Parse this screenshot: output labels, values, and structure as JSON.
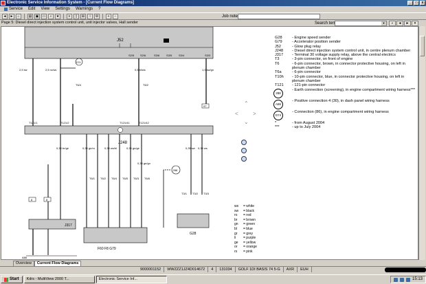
{
  "window": {
    "title": "Electronic Service Information System - [Current Flow Diagrams]"
  },
  "menu": [
    "Service",
    "Edit",
    "View",
    "Settings",
    "Warnings",
    "?"
  ],
  "toolbar": {
    "job_note_label": "Job note:",
    "job_note_value": ""
  },
  "page": {
    "title": "Page 5: Diesel direct injection system control unit, unit injector valves, Hall sender"
  },
  "search": {
    "label": "Search term:",
    "value": ""
  },
  "legend": [
    {
      "key": "G28",
      "text": "- Engine speed sender"
    },
    {
      "key": "G79",
      "text": "- Accelerator position sender"
    },
    {
      "key": "J52",
      "text": "- Glow plug relay"
    },
    {
      "key": "J248",
      "text": "- Diesel direct injection system control unit, in centre plenum chamber"
    },
    {
      "key": "J317",
      "text": "- Terminal 30 voltage supply relay, above the central electrics"
    },
    {
      "key": "T3",
      "text": "- 3-pin connector, on front of engine"
    },
    {
      "key": "T6",
      "text": "- 6-pin connector, brown, in connector protective housing, on left in plenum chamber"
    },
    {
      "key": "T6a",
      "text": "- 6-pin connector"
    },
    {
      "key": "T10h",
      "text": "- 10-pin connector, blue, in connector protective housing, on left in plenum chamber"
    },
    {
      "key": "T121",
      "text": "- 121-pin connector"
    },
    {
      "key": "288",
      "text": "- Earth connection (screening), in engine compartment wiring harness***",
      "circle": true
    },
    {
      "key": "A86",
      "text": "- Positive connection 4 (30), in dash panel wiring harness",
      "circle": true
    },
    {
      "key": "D74",
      "text": "- Connection (86), in engine compartment wiring harness",
      "circle": true
    },
    {
      "key": "*",
      "text": "- from August 2004"
    },
    {
      "key": "***",
      "text": "- up to July 2004"
    }
  ],
  "colors": [
    {
      "code": "ws",
      "name": "= white"
    },
    {
      "code": "sw",
      "name": "= black"
    },
    {
      "code": "ro",
      "name": "= red"
    },
    {
      "code": "br",
      "name": "= brown"
    },
    {
      "code": "gn",
      "name": "= green"
    },
    {
      "code": "bl",
      "name": "= blue"
    },
    {
      "code": "gr",
      "name": "= grey"
    },
    {
      "code": "li",
      "name": "= purple"
    },
    {
      "code": "ge",
      "name": "= yellow"
    },
    {
      "code": "or",
      "name": "= orange"
    },
    {
      "code": "rs",
      "name": "= pink"
    }
  ],
  "diagram": {
    "j52": "J52",
    "j248": "J248",
    "j317": "J317",
    "g28": "G28",
    "g79": "F60  F8  G79",
    "d74": "D74",
    "a86": "A86",
    "n288": "288",
    "top_pins": [
      "S2/5",
      "S2/6",
      "S3/6",
      "S3/5",
      "S3/4",
      "S3/3"
    ],
    "t121": [
      "T121/1",
      "T121/2",
      "T121/41",
      "T121/42",
      "T121/8"
    ],
    "wires": [
      "2,5 sw",
      "2,5 ro/ws",
      "0,5 bl/ws",
      "1,0 sw/gn",
      "0,35 br/ge",
      "0,35 gn/ro",
      "0,35 ws/bl",
      "0,35 gn/ge",
      "0,35 ge/gn",
      "0,35 ge/br",
      "0,35 sw",
      "0,35 ws",
      "0,35 br"
    ],
    "ref_boxes": [
      "8",
      "8",
      "84",
      "97",
      "122",
      "123",
      "124",
      "125",
      "126",
      "127"
    ],
    "conn_labels": [
      "T6/1",
      "T6/2",
      "T6/4",
      "T6/5",
      "T6/3",
      "T6/6",
      "T3/1",
      "T3/2",
      "T3/3"
    ],
    "bottom": [
      "A86",
      "J317"
    ]
  },
  "tabs": [
    "Overview",
    "Current Flow Diagrams"
  ],
  "status": [
    "9000001152",
    "WWZZZ1JZ4D014672",
    "4",
    "131034",
    "GOLF 1DI BASIS 74 5-G",
    "AXR",
    "EUH"
  ],
  "taskbar": {
    "start": "Start",
    "tasks": [
      "Kdrs - MultiView 2000 T...",
      "Electronic Service Inf..."
    ],
    "clock": "15:13"
  }
}
